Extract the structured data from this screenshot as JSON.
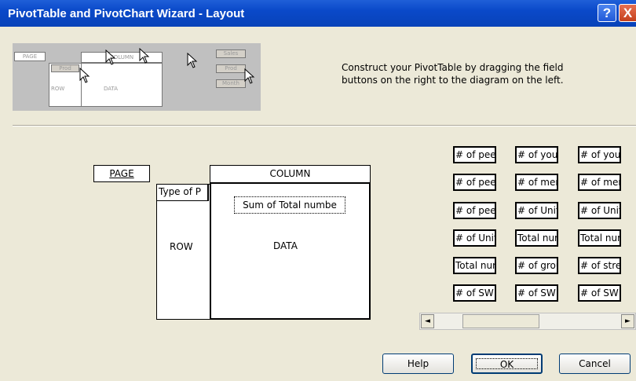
{
  "window": {
    "title": "PivotTable and PivotChart Wizard - Layout",
    "help_glyph": "?",
    "close_glyph": "X"
  },
  "preview": {
    "page": "PAGE",
    "column": "COLUMN",
    "row": "ROW",
    "data": "DATA",
    "prod_top": "Prod",
    "sales": "Sales",
    "prod_side": "Prod",
    "month": "Month"
  },
  "instructions": "Construct your PivotTable by dragging the field buttons on the right to the diagram on the left.",
  "layout": {
    "page_label": "PAGE",
    "column_label": "COLUMN",
    "row_label": "ROW",
    "data_label": "DATA",
    "row_field": "Type of P",
    "data_field": "Sum of Total numbe"
  },
  "fields": [
    "# of peer",
    "# of yout",
    "# of yout",
    "# of peer",
    "# of men",
    "# of men",
    "# of peer",
    "# of Unifo",
    "# of Unifo",
    "# of Unifo",
    "Total num",
    "Total num",
    "Total num",
    "# of grou",
    "# of stree",
    "# of SW r",
    "# of SW r",
    "# of SW r"
  ],
  "scrollbar": {
    "left_arrow": "◄",
    "right_arrow": "►"
  },
  "buttons": {
    "help": "Help",
    "ok": "OK",
    "cancel": "Cancel"
  }
}
